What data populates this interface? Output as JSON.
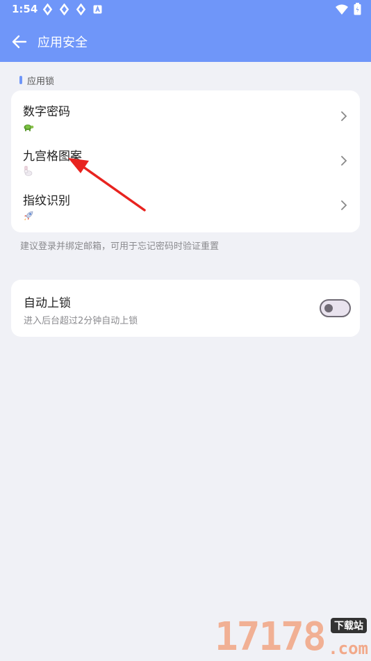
{
  "status_bar": {
    "time": "1:54",
    "notification_icons": [
      "sync-icon",
      "sync-icon",
      "sync-icon",
      "a-icon"
    ],
    "right_icons": [
      "wifi-icon",
      "battery-icon"
    ]
  },
  "app_bar": {
    "title": "应用安全",
    "background": "#6f96f9"
  },
  "app_lock_section": {
    "header": "应用锁",
    "items": [
      {
        "label": "数字密码",
        "icon": "turtle-icon"
      },
      {
        "label": "九宫格图案",
        "icon": "rabbit-icon"
      },
      {
        "label": "指纹识别",
        "icon": "rocket-icon"
      }
    ],
    "hint": "建议登录并绑定邮箱，可用于忘记密码时验证重置"
  },
  "auto_lock": {
    "title": "自动上锁",
    "subtitle": "进入后台超过2分钟自动上锁",
    "enabled": false
  },
  "annotation": {
    "color": "#e8231f",
    "points_to": "九宫格图案"
  },
  "watermark": {
    "number": "17178",
    "badge": "下载站",
    "suffix": ".com"
  }
}
